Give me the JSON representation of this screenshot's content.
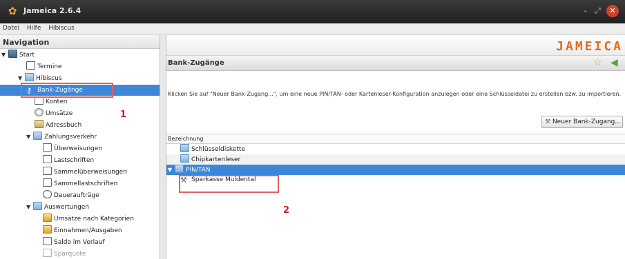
{
  "window": {
    "title": "Jameica 2.6.4",
    "minimize": "–",
    "maximize": "⤢",
    "close": "✕"
  },
  "menu": [
    "Datei",
    "Hilfe",
    "Hibiscus"
  ],
  "navigation": {
    "header": "Navigation",
    "items": [
      {
        "label": "Start",
        "level": 0,
        "expanded": true,
        "icon": "computer-icon"
      },
      {
        "label": "Termine",
        "level": 1,
        "icon": "calendar-icon"
      },
      {
        "label": "Hibiscus",
        "level": 1,
        "expanded": true,
        "icon": "folder-icon"
      },
      {
        "label": "Bank-Zugänge",
        "level": 2,
        "icon": "key-icon",
        "selected": true
      },
      {
        "label": "Konten",
        "level": 2,
        "icon": "accounts-icon"
      },
      {
        "label": "Umsätze",
        "level": 2,
        "icon": "cd-icon"
      },
      {
        "label": "Adressbuch",
        "level": 2,
        "icon": "address-book-icon"
      },
      {
        "label": "Zahlungsverkehr",
        "level": 2,
        "expanded": true,
        "icon": "folder-icon"
      },
      {
        "label": "Überweisungen",
        "level": 3,
        "icon": "transfer-icon"
      },
      {
        "label": "Lastschriften",
        "level": 3,
        "icon": "debit-icon"
      },
      {
        "label": "Sammelüberweisungen",
        "level": 3,
        "icon": "bulk-transfer-icon"
      },
      {
        "label": "Sammellastschriften",
        "level": 3,
        "icon": "bulk-debit-icon"
      },
      {
        "label": "Daueraufträge",
        "level": 3,
        "icon": "clock-icon"
      },
      {
        "label": "Auswertungen",
        "level": 2,
        "expanded": true,
        "icon": "folder-icon"
      },
      {
        "label": "Umsätze nach Kategorien",
        "level": 3,
        "icon": "pie-icon"
      },
      {
        "label": "Einnahmen/Ausgaben",
        "level": 3,
        "icon": "chart-icon"
      },
      {
        "label": "Saldo im Verlauf",
        "level": 3,
        "icon": "graph-icon"
      },
      {
        "label": "Sparquote",
        "level": 3,
        "icon": "graph-icon"
      }
    ]
  },
  "annotations": {
    "marker_1": "1",
    "marker_2": "2"
  },
  "main": {
    "logo": "JAMEICA",
    "title": "Bank-Zugänge",
    "description": "Klicken Sie auf \"Neuer Bank-Zugang...\", um eine neue PIN/TAN- oder Kartenleser-Konfiguration anzulegen oder eine Schlüsseldatei zu erstellen bzw. zu importieren.",
    "new_button": "Neuer Bank-Zugang...",
    "table": {
      "column": "Bezeichnung",
      "rows": [
        {
          "label": "Schlüsseldiskette",
          "level": 0
        },
        {
          "label": "Chipkartenleser",
          "level": 0
        },
        {
          "label": "PIN/TAN",
          "level": 0,
          "expanded": true,
          "selected": true
        },
        {
          "label": "Sparkasse Muldental",
          "level": 1
        }
      ]
    }
  },
  "colors": {
    "selection": "#3d86d9",
    "annotation": "#e06060",
    "logo": "#e36c14"
  }
}
